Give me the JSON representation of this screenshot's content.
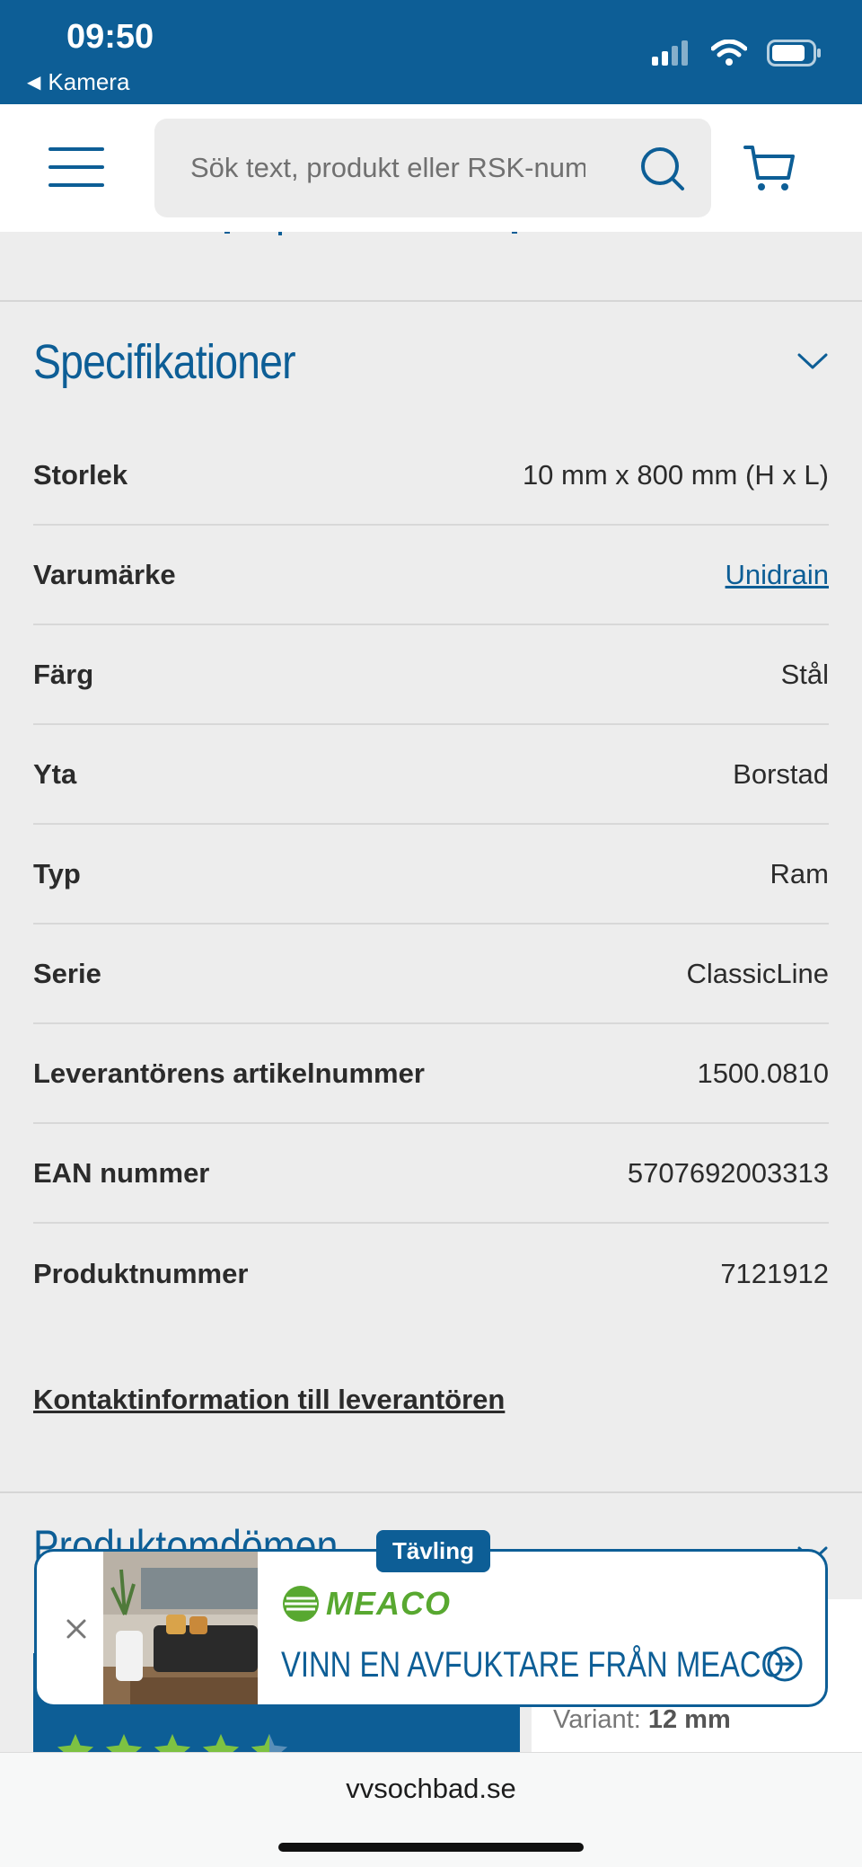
{
  "status_bar": {
    "time": "09:50",
    "back_label": "Kamera",
    "icons": [
      "signal-icon",
      "wifi-icon",
      "battery-icon"
    ]
  },
  "header": {
    "search_placeholder": "Sök text, produkt eller RSK-num",
    "icons": [
      "menu-icon",
      "search-icon",
      "cart-icon"
    ]
  },
  "specs": {
    "title": "Specifikationer",
    "rows": [
      {
        "label": "Storlek",
        "value": "10 mm x 800 mm (H x L)",
        "link": false
      },
      {
        "label": "Varumärke",
        "value": "Unidrain",
        "link": true
      },
      {
        "label": "Färg",
        "value": "Stål",
        "link": false
      },
      {
        "label": "Yta",
        "value": "Borstad",
        "link": false
      },
      {
        "label": "Typ",
        "value": "Ram",
        "link": false
      },
      {
        "label": "Serie",
        "value": "ClassicLine",
        "link": false
      },
      {
        "label": "Leverantörens artikelnummer",
        "value": "1500.0810",
        "link": false
      },
      {
        "label": "EAN nummer",
        "value": "5707692003313",
        "link": false
      },
      {
        "label": "Produktnummer",
        "value": "7121912",
        "link": false
      }
    ],
    "contact_link": "Kontaktinformation till leverantören"
  },
  "reviews": {
    "title": "Produktomdömen",
    "variant_label": "Variant:",
    "variant_value": "12 mm",
    "star_rating": 4.5
  },
  "promo": {
    "badge": "Tävling",
    "brand": "MEACO",
    "headline": "VINN EN AVFUKTARE FRÅN MEACO"
  },
  "browser": {
    "url": "vvsochbad.se"
  },
  "colors": {
    "brand_blue": "#0d5e96",
    "star_green": "#7dc242",
    "meaco_green": "#58a830"
  }
}
